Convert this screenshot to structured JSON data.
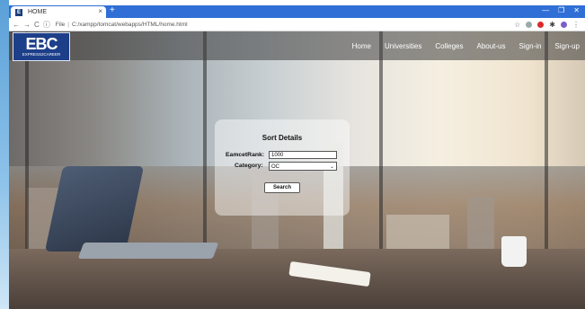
{
  "browser": {
    "tab_title": "HOME",
    "new_tab": "+",
    "url_prefix": "File",
    "url": "C:/xampp/tomcat/webapps/HTML/home.html",
    "controls": [
      "—",
      "❐",
      "✕"
    ]
  },
  "site": {
    "logo_mark": "EBC",
    "logo_sub": "EXPRESS2CAREER",
    "nav": [
      "Home",
      "Universities",
      "Colleges",
      "About-us",
      "Sign-in",
      "Sign-up"
    ]
  },
  "form": {
    "title": "Sort Details",
    "rank_label": "EamcetRank:",
    "rank_value": "1000",
    "category_label": "Category:",
    "category_value": "OC",
    "search_label": "Search"
  },
  "colors": {
    "tabbar": "#2f6fd6",
    "logo_bg": "#1d3f8a"
  }
}
